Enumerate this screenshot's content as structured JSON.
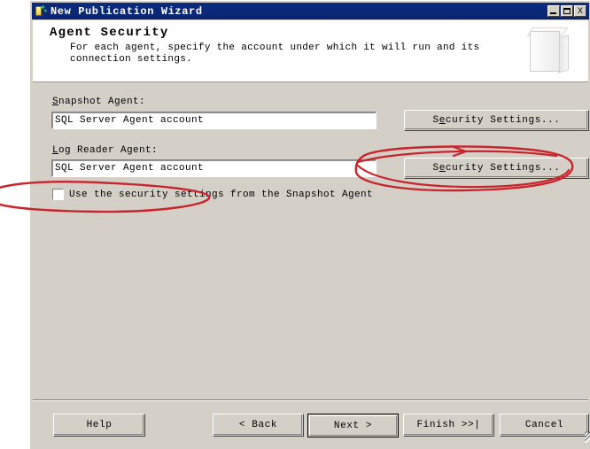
{
  "window": {
    "title": "New Publication Wizard",
    "icon": "publication-wizard-icon",
    "minimize_label": "_",
    "maximize_label": "□",
    "close_label": "X"
  },
  "header": {
    "title": "Agent Security",
    "description": "For each agent, specify the account under which it will run and its connection settings.",
    "icon": "publication-book-icon"
  },
  "main": {
    "snapshot_agent": {
      "label_accel": "S",
      "label_rest": "napshot Agent:",
      "value": "SQL Server Agent account",
      "button_accel": "e",
      "button_pre": "S",
      "button_post": "curity Settings..."
    },
    "log_reader_agent": {
      "label_accel": "L",
      "label_rest": "og Reader Agent:",
      "value": "SQL Server Agent account",
      "button_accel": "e",
      "button_pre": "S",
      "button_post": "curity Settings..."
    },
    "checkbox": {
      "label": "Use the security settings from the Snapshot Agent",
      "checked": false
    }
  },
  "footer": {
    "help_label": "Help",
    "back_label": "< Back",
    "next_label": "Next >",
    "finish_label": "Finish >>|",
    "cancel_label": "Cancel"
  },
  "annotations": {
    "color": "#c8242c",
    "items": [
      "ellipse-around-checkbox",
      "ellipse-around-log-reader-security-settings",
      "arrow-pointing-to-security-settings"
    ]
  }
}
